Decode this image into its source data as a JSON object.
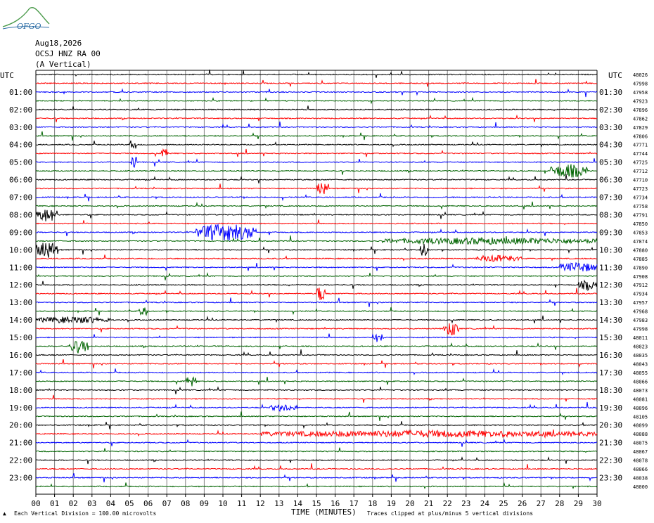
{
  "header": {
    "logo_text": "OFGO",
    "date": "Aug18,2026",
    "station": "OCSJ HNZ RA 00",
    "component": "(A Vertical)"
  },
  "footer": {
    "scale_note": "Each Vertical Division = 100.00 microvolts",
    "clip_note": "Traces clipped at plus/minus 5 vertical divisions",
    "x_axis_title": "TIME (MINUTES)"
  },
  "colors": {
    "trace_cycle": [
      "#000000",
      "#ff0000",
      "#0000ff",
      "#006400"
    ],
    "grid": "#808080"
  },
  "chart_data": {
    "type": "line",
    "title": "",
    "xlabel": "TIME (MINUTES)",
    "ylabel": "",
    "x_range": [
      0,
      30
    ],
    "x_ticks": [
      "00",
      "01",
      "02",
      "03",
      "04",
      "05",
      "06",
      "07",
      "08",
      "09",
      "10",
      "11",
      "12",
      "13",
      "14",
      "15",
      "16",
      "17",
      "18",
      "19",
      "20",
      "21",
      "22",
      "23",
      "24",
      "25",
      "26",
      "27",
      "28",
      "29",
      "30"
    ],
    "left_axis_label": "UTC",
    "right_axis_label": "UTC",
    "left_hour_labels": [
      "01:00",
      "02:00",
      "03:00",
      "04:00",
      "05:00",
      "06:00",
      "07:00",
      "08:00",
      "09:00",
      "10:00",
      "11:00",
      "12:00",
      "13:00",
      "14:00",
      "15:00",
      "16:00",
      "17:00",
      "18:00",
      "19:00",
      "20:00",
      "21:00",
      "22:00",
      "23:00"
    ],
    "right_half_labels": [
      "01:30",
      "02:30",
      "03:30",
      "04:30",
      "05:30",
      "06:30",
      "07:30",
      "08:30",
      "09:30",
      "10:30",
      "11:30",
      "12:30",
      "13:30",
      "14:30",
      "15:30",
      "16:30",
      "17:30",
      "18:30",
      "19:30",
      "20:30",
      "21:30",
      "22:30",
      "23:30"
    ],
    "right_top_label": "48026",
    "trace_offsets": [
      47998,
      47958,
      47923,
      47896,
      47862,
      47829,
      47806,
      47771,
      47744,
      47725,
      47712,
      47710,
      47723,
      47734,
      47758,
      47791,
      47850,
      47853,
      47874,
      47880,
      47885,
      47890,
      47908,
      47912,
      47934,
      47957,
      47968,
      47983,
      47998,
      48011,
      48023,
      48035,
      48043,
      48055,
      48066,
      48073,
      48081,
      48096,
      48105,
      48099,
      48088,
      48075,
      48067,
      48078,
      48066,
      48038,
      48000
    ],
    "activity_bursts": [
      {
        "trace": 8,
        "start_min": 5.0,
        "end_min": 5.4,
        "amp": 4
      },
      {
        "trace": 9,
        "start_min": 6.7,
        "end_min": 7.1,
        "amp": 3
      },
      {
        "trace": 10,
        "start_min": 5.1,
        "end_min": 5.4,
        "amp": 5
      },
      {
        "trace": 11,
        "start_min": 27.5,
        "end_min": 29.5,
        "amp": 4
      },
      {
        "trace": 13,
        "start_min": 15.0,
        "end_min": 15.6,
        "amp": 4
      },
      {
        "trace": 16,
        "start_min": 0.0,
        "end_min": 1.2,
        "amp": 4
      },
      {
        "trace": 18,
        "start_min": 8.5,
        "end_min": 11.8,
        "amp": 5
      },
      {
        "trace": 19,
        "start_min": 18.5,
        "end_min": 30.0,
        "amp": 2
      },
      {
        "trace": 20,
        "start_min": 0.0,
        "end_min": 1.2,
        "amp": 5
      },
      {
        "trace": 20,
        "start_min": 20.5,
        "end_min": 21.0,
        "amp": 4
      },
      {
        "trace": 21,
        "start_min": 23.5,
        "end_min": 26.0,
        "amp": 2
      },
      {
        "trace": 22,
        "start_min": 28.0,
        "end_min": 30.0,
        "amp": 3
      },
      {
        "trace": 24,
        "start_min": 29.0,
        "end_min": 30.0,
        "amp": 3
      },
      {
        "trace": 25,
        "start_min": 15.0,
        "end_min": 15.5,
        "amp": 5
      },
      {
        "trace": 27,
        "start_min": 5.5,
        "end_min": 6.0,
        "amp": 3
      },
      {
        "trace": 28,
        "start_min": 0.0,
        "end_min": 4.0,
        "amp": 2
      },
      {
        "trace": 29,
        "start_min": 21.8,
        "end_min": 22.6,
        "amp": 4
      },
      {
        "trace": 30,
        "start_min": 18.0,
        "end_min": 18.6,
        "amp": 3
      },
      {
        "trace": 31,
        "start_min": 1.8,
        "end_min": 2.8,
        "amp": 4
      },
      {
        "trace": 35,
        "start_min": 8.0,
        "end_min": 8.6,
        "amp": 3
      },
      {
        "trace": 38,
        "start_min": 12.5,
        "end_min": 14.0,
        "amp": 2
      },
      {
        "trace": 41,
        "start_min": 12.0,
        "end_min": 30.0,
        "amp": 2
      }
    ]
  }
}
